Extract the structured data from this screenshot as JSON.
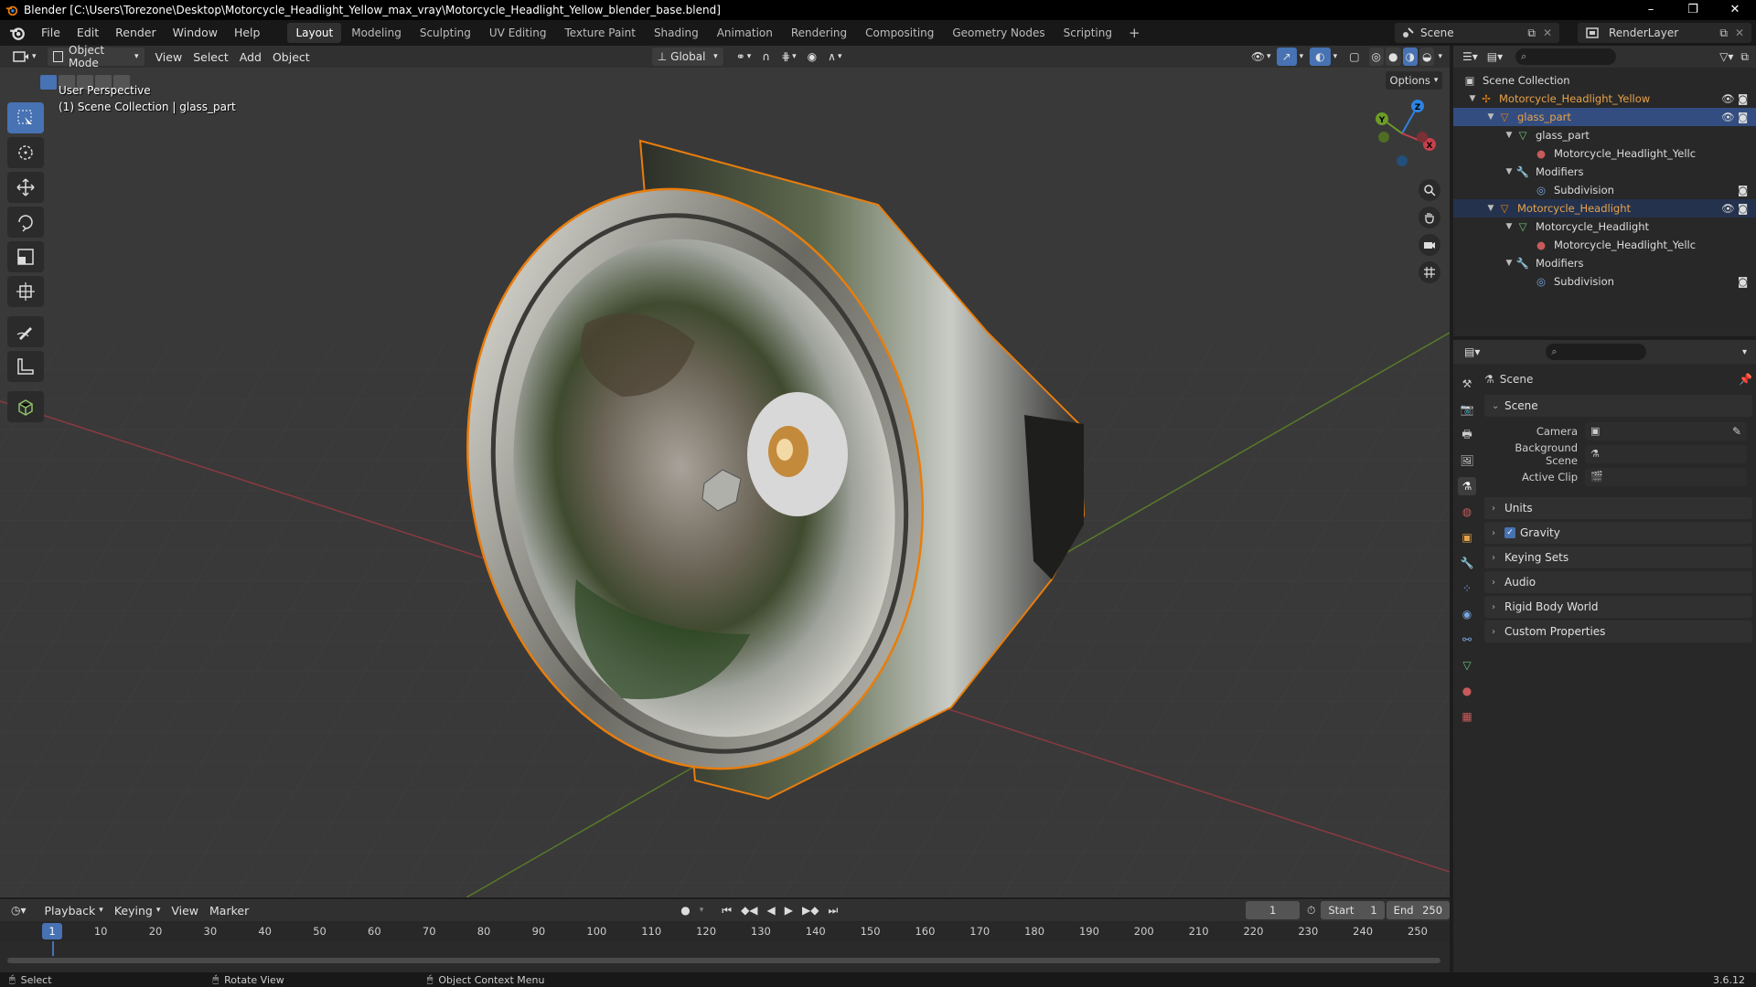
{
  "window": {
    "title": "Blender [C:\\Users\\Torezone\\Desktop\\Motorcycle_Headlight_Yellow_max_vray\\Motorcycle_Headlight_Yellow_blender_base.blend]",
    "minimize": "–",
    "maximize": "❐",
    "close": "✕"
  },
  "menu": [
    "File",
    "Edit",
    "Render",
    "Window",
    "Help"
  ],
  "workspaces": [
    "Layout",
    "Modeling",
    "Sculpting",
    "UV Editing",
    "Texture Paint",
    "Shading",
    "Animation",
    "Rendering",
    "Compositing",
    "Geometry Nodes",
    "Scripting"
  ],
  "active_workspace": "Layout",
  "scene_name": "Scene",
  "render_layer": "RenderLayer",
  "viewport_header": {
    "mode": "Object Mode",
    "menus": [
      "View",
      "Select",
      "Add",
      "Object"
    ],
    "orientation": "Global",
    "options": "Options"
  },
  "viewport": {
    "perspective": "User Perspective",
    "collection_info": "(1) Scene Collection | glass_part",
    "gizmo_labels": {
      "z": "Z",
      "y": "Y",
      "x": "X"
    }
  },
  "outliner": {
    "rows": [
      {
        "label": "Scene Collection"
      },
      {
        "label": "Motorcycle_Headlight_Yellow"
      },
      {
        "label": "glass_part"
      },
      {
        "label": "glass_part"
      },
      {
        "label": "Motorcycle_Headlight_Yellc"
      },
      {
        "label": "Modifiers"
      },
      {
        "label": "Subdivision"
      },
      {
        "label": "Motorcycle_Headlight"
      },
      {
        "label": "Motorcycle_Headlight"
      },
      {
        "label": "Motorcycle_Headlight_Yellc"
      },
      {
        "label": "Modifiers"
      },
      {
        "label": "Subdivision"
      }
    ]
  },
  "properties": {
    "context": "Scene",
    "section": "Scene",
    "fields": {
      "camera": "Camera",
      "background_scene": "Background Scene",
      "active_clip": "Active Clip"
    },
    "panels": [
      "Units",
      "Gravity",
      "Keying Sets",
      "Audio",
      "Rigid Body World",
      "Custom Properties"
    ]
  },
  "timeline": {
    "menus": [
      "Playback",
      "Keying",
      "View",
      "Marker"
    ],
    "current_frame": "1",
    "start_label": "Start",
    "start": "1",
    "end_label": "End",
    "end": "250",
    "frame_numbers": [
      "10",
      "20",
      "30",
      "40",
      "50",
      "60",
      "70",
      "80",
      "90",
      "100",
      "110",
      "120",
      "130",
      "140",
      "150",
      "160",
      "170",
      "180",
      "190",
      "200",
      "210",
      "220",
      "230",
      "240",
      "250"
    ]
  },
  "statusbar": {
    "select": "Select",
    "rotate": "Rotate View",
    "context_menu": "Object Context Menu",
    "version": "3.6.12"
  },
  "colors": {
    "selection_orange": "#e87d0d",
    "active_blue": "#4772b3",
    "axis_x": "#c8404a",
    "axis_y": "#6c9b28",
    "axis_z": "#2f83e0"
  }
}
